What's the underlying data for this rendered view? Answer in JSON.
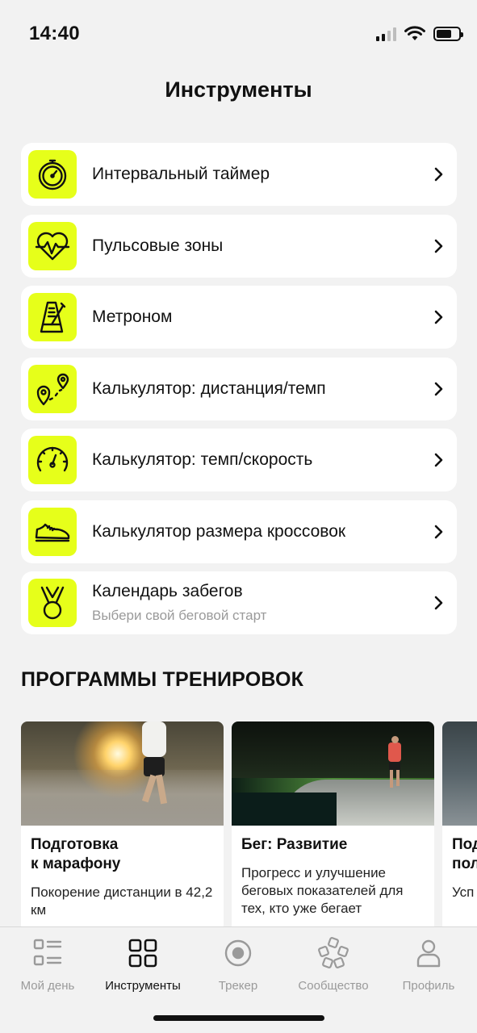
{
  "status_bar": {
    "time": "14:40"
  },
  "page_title": "Инструменты",
  "tools": [
    {
      "label": "Интервальный таймер",
      "icon": "stopwatch-icon"
    },
    {
      "label": "Пульсовые зоны",
      "icon": "heart-pulse-icon"
    },
    {
      "label": "Метроном",
      "icon": "metronome-icon"
    },
    {
      "label": "Калькулятор: дистанция/темп",
      "icon": "route-pin-icon"
    },
    {
      "label": "Калькулятор: темп/скорость",
      "icon": "speedometer-icon"
    },
    {
      "label": "Калькулятор размера кроссовок",
      "icon": "sneaker-icon"
    },
    {
      "label": "Календарь забегов",
      "subtitle": "Выбери свой беговой старт",
      "icon": "medal-icon"
    }
  ],
  "accent_color": "#e6ff1a",
  "programs_section": {
    "title": "ПРОГРАММЫ ТРЕНИРОВОК",
    "cards": [
      {
        "title_line1": "Подготовка",
        "title_line2": "к марафону",
        "description": "Покорение дистанции в 42,2 км"
      },
      {
        "title_line1": "Бег: Развитие",
        "title_line2": "",
        "description": "Прогресс и улучшение беговых показателей для тех, кто уже бегает"
      },
      {
        "title_line1": "Под",
        "title_line2": "пол",
        "description": "Усп дис"
      }
    ]
  },
  "tab_bar": {
    "tabs": [
      {
        "label": "Мой день",
        "icon": "grid-list-icon",
        "active": false
      },
      {
        "label": "Инструменты",
        "icon": "four-squares-icon",
        "active": true
      },
      {
        "label": "Трекер",
        "icon": "record-circle-icon",
        "active": false
      },
      {
        "label": "Сообщество",
        "icon": "community-icon",
        "active": false
      },
      {
        "label": "Профиль",
        "icon": "person-icon",
        "active": false
      }
    ]
  }
}
